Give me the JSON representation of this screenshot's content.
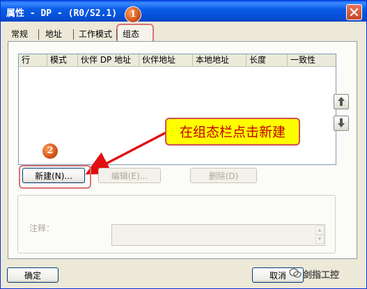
{
  "window": {
    "title": "属性 - DP - (R0/S2.1)",
    "close_label": "×"
  },
  "annotations": {
    "badge1": "1",
    "badge2": "2",
    "callout": "在组态栏点击新建"
  },
  "tabs": [
    {
      "label": "常规"
    },
    {
      "label": "地址"
    },
    {
      "label": "工作模式"
    },
    {
      "label": "组态"
    }
  ],
  "table": {
    "columns": [
      "行",
      "模式",
      "伙伴 DP 地址",
      "伙伴地址",
      "本地地址",
      "长度",
      "一致性"
    ]
  },
  "buttons": {
    "new": "新建(N)...",
    "edit": "编辑(E)...",
    "delete": "删除(D)",
    "ok": "确定",
    "cancel": "取消"
  },
  "comment": {
    "label": "注释：",
    "value": ""
  },
  "watermark": "剑指工控"
}
